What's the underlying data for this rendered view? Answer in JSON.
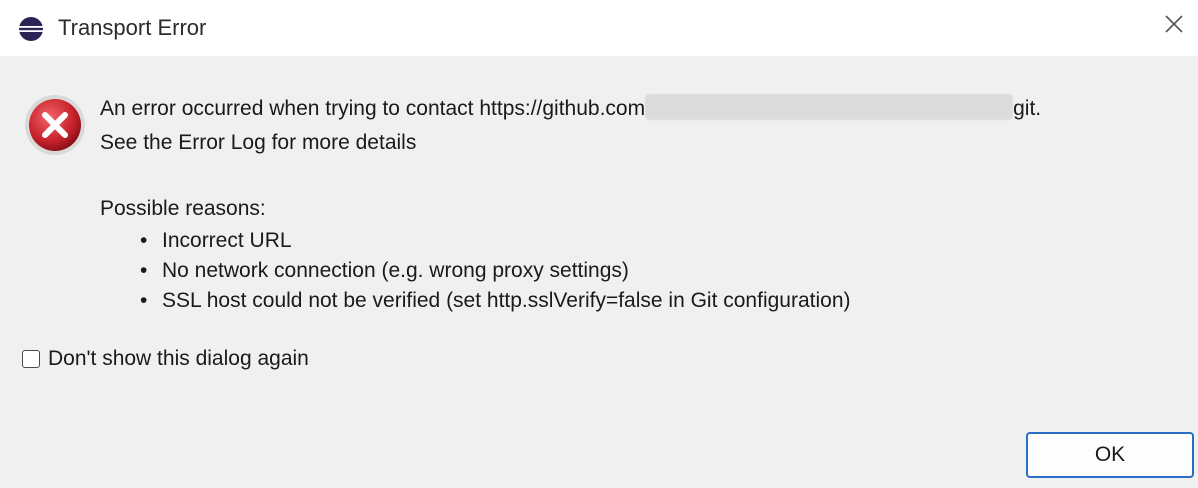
{
  "window": {
    "title": "Transport Error",
    "app_icon": "eclipse-icon",
    "close_icon": "close-icon"
  },
  "message": {
    "icon": "error-icon",
    "line1_prefix": "An error occurred when trying to contact https://github.com",
    "line1_suffix": "git.",
    "line2": "See the Error Log for more details"
  },
  "reasons": {
    "heading": "Possible reasons:",
    "bullet": "•",
    "items": [
      "Incorrect URL",
      "No network connection (e.g. wrong proxy settings)",
      "SSL host could not be verified (set http.sslVerify=false in Git configuration)"
    ]
  },
  "checkbox": {
    "label": "Don't show this dialog again",
    "checked": false
  },
  "buttons": {
    "ok_label": "OK"
  },
  "colors": {
    "dialog_bg": "#f0f0f0",
    "titlebar_bg": "#ffffff",
    "error_red": "#c8222b",
    "ok_border": "#2a6fc7"
  }
}
